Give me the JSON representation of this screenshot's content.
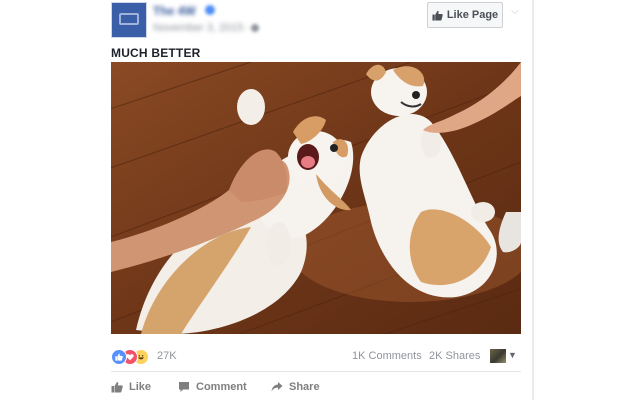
{
  "post": {
    "page_name": "The 4W",
    "meta": "November 3, 2015 ·",
    "like_page_label": "Like Page",
    "caption": "MUCH BETTER"
  },
  "stats": {
    "reaction_count": "27K",
    "comments": "1K Comments",
    "shares": "2K Shares"
  },
  "actions": {
    "like": "Like",
    "comment": "Comment",
    "share": "Share"
  },
  "colors": {
    "accent": "#365899",
    "like_blue": "#5890ff",
    "love_red": "#f25268",
    "haha_yellow": "#fcd25c",
    "muted": "#90949c"
  }
}
